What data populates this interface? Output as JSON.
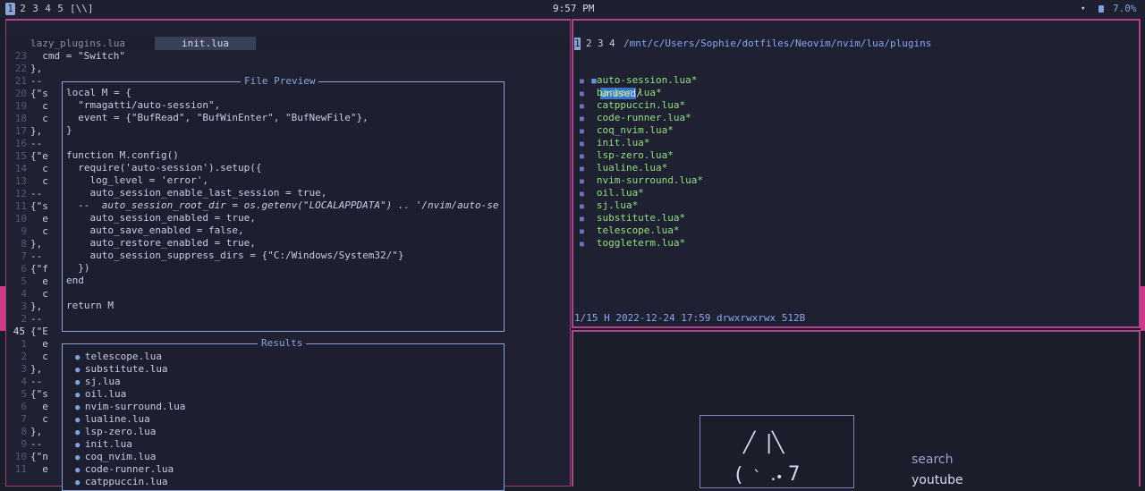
{
  "topbar": {
    "workspaces": [
      "1",
      "2",
      "3",
      "4",
      "5"
    ],
    "active_workspace": "1",
    "layout_indicator": "[\\\\]",
    "clock": "9:57 PM",
    "tray_arrow": "▾",
    "battery_icon": "battery-icon",
    "battery": "7.0%"
  },
  "editor": {
    "tabs": [
      "lazy_plugins.lua",
      "init.lua"
    ],
    "active_tab": "init.lua",
    "top_line_numbers": [
      "23",
      "22",
      "21",
      "20",
      "19",
      "18",
      "17",
      "16",
      "15",
      "14",
      "13",
      "12",
      "11",
      "10",
      "9",
      "8",
      "7",
      "6",
      "5",
      "4",
      "3",
      "2"
    ],
    "current_line": "45",
    "bottom_line_numbers": [
      "1",
      "2",
      "3",
      "4",
      "5",
      "6",
      "7",
      "8",
      "9",
      "10",
      "11"
    ],
    "code_top": [
      "  cmd = \"Switch\"",
      "},",
      "--",
      "{\"s",
      "  c",
      "  c",
      "},",
      "--",
      "{\"e",
      "  c",
      "  c",
      "--",
      "{\"s",
      "  e",
      "  c",
      "},",
      "--",
      "{\"f",
      "  e",
      "  c",
      "},",
      "--"
    ],
    "code_bottom": [
      "{\"E",
      "  e",
      "  c",
      "},",
      "--",
      "{\"s",
      "  e",
      "  c",
      "},",
      "--",
      "{\"n",
      "  e"
    ]
  },
  "preview": {
    "title": "File Preview",
    "lines": [
      {
        "t": "local M = {",
        "c": "kw"
      },
      {
        "t": "  \"rmagatti/auto-session\",",
        "c": "str"
      },
      {
        "t": "  event = {\"BufRead\", \"BufWinEnter\", \"BufNewFile\"},",
        "c": ""
      },
      {
        "t": "}",
        "c": ""
      },
      {
        "t": "",
        "c": ""
      },
      {
        "t": "function M.config()",
        "c": "fn"
      },
      {
        "t": "  require('auto-session').setup({",
        "c": ""
      },
      {
        "t": "    log_level = 'error',",
        "c": ""
      },
      {
        "t": "    auto_session_enable_last_session = true,",
        "c": ""
      },
      {
        "t": "  --  auto_session_root_dir = os.getenv(\"LOCALAPPDATA\") .. '/nvim/auto-se",
        "c": "cmt"
      },
      {
        "t": "    auto_session_enabled = true,",
        "c": ""
      },
      {
        "t": "    auto_save_enabled = false,",
        "c": ""
      },
      {
        "t": "    auto_restore_enabled = true,",
        "c": ""
      },
      {
        "t": "    auto_session_suppress_dirs = {\"C:/Windows/System32/\"}",
        "c": ""
      },
      {
        "t": "  })",
        "c": ""
      },
      {
        "t": "end",
        "c": "kw"
      },
      {
        "t": "",
        "c": ""
      },
      {
        "t": "return M",
        "c": ""
      }
    ]
  },
  "results": {
    "title": "Results",
    "items": [
      "telescope.lua",
      "substitute.lua",
      "sj.lua",
      "oil.lua",
      "nvim-surround.lua",
      "lualine.lua",
      "lsp-zero.lua",
      "init.lua",
      "coq_nvim.lua",
      "code-runner.lua",
      "catppuccin.lua"
    ]
  },
  "filemanager": {
    "tabs": [
      "1",
      "2",
      "3",
      "4"
    ],
    "active_tab": "1",
    "path": "/mnt/c/Users/Sophie/dotfiles/Neovim/nvim/lua/plugins",
    "dir_entry": "unused",
    "dir_suffix": "/",
    "files": [
      "auto-session.lua*",
      "barbar.lua*",
      "catppuccin.lua*",
      "code-runner.lua*",
      "coq_nvim.lua*",
      "init.lua*",
      "lsp-zero.lua*",
      "lualine.lua*",
      "nvim-surround.lua*",
      "oil.lua*",
      "sj.lua*",
      "substitute.lua*",
      "telescope.lua*",
      "toggleterm.lua*"
    ],
    "status": "1/15 H 2022-12-24 17:59 drwxrwxrwx 512B"
  },
  "widget": {
    "clock_glyphs": [
      "╱",
      "|",
      "╲",
      "(",
      "`",
      ".",
      "•",
      "7"
    ],
    "menu": [
      "search",
      "youtube"
    ]
  },
  "colors": {
    "accent": "#b0448d",
    "selection": "#3b73c9",
    "file_green": "#8ee27a",
    "border_blue": "#8aa6d8"
  }
}
